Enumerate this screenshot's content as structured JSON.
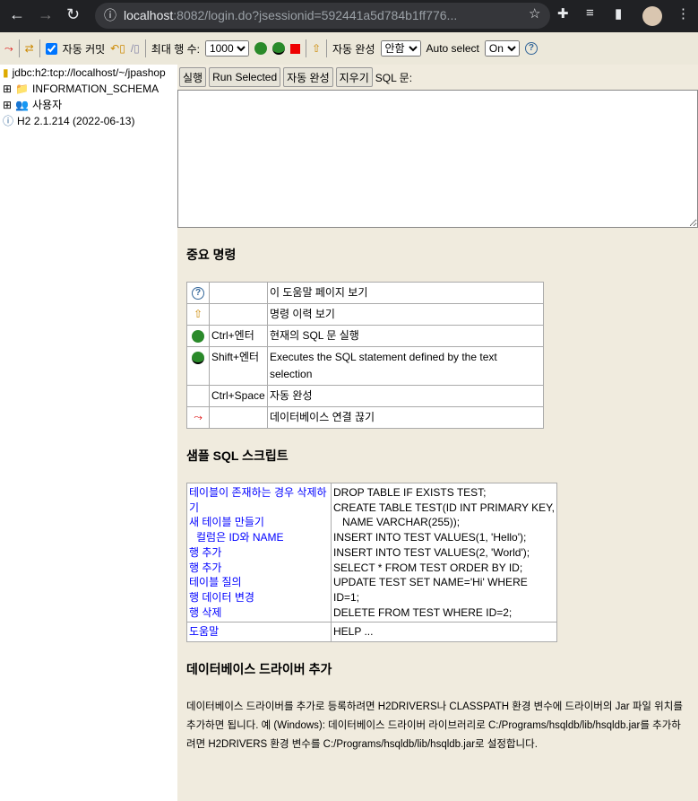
{
  "browser": {
    "url_host": "localhost",
    "url_rest": ":8082/login.do?jsessionid=592441a5d784b1ff776..."
  },
  "toolbar": {
    "autocommit_label": "자동 커밋",
    "autocommit_checked": true,
    "max_rows_label": "최대 행 수:",
    "max_rows_value": "1000",
    "autocomplete_label": "자동 완성",
    "autocomplete_value": "안함",
    "autoselect_label": "Auto select",
    "autoselect_value": "On"
  },
  "tree": {
    "connection": "jdbc:h2:tcp://localhost/~/jpashop",
    "items": [
      "INFORMATION_SCHEMA",
      "사용자"
    ],
    "version": "H2 2.1.214 (2022-06-13)"
  },
  "buttons": {
    "run": "실행",
    "run_selected": "Run Selected",
    "autocomplete": "자동 완성",
    "clear": "지우기",
    "sql_label": "SQL 문:"
  },
  "help": {
    "important_title": "중요 명령",
    "commands": [
      {
        "icon": "help-icon",
        "key": "",
        "desc": "이 도움말 페이지 보기"
      },
      {
        "icon": "history-icon",
        "key": "",
        "desc": "명령 이력 보기"
      },
      {
        "icon": "run-icon",
        "key": "Ctrl+엔터",
        "desc": "현재의 SQL 문 실행"
      },
      {
        "icon": "run-selected-icon",
        "key": "Shift+엔터",
        "desc": "Executes the SQL statement defined by the text selection"
      },
      {
        "icon": "",
        "key": "Ctrl+Space",
        "desc": "자동 완성"
      },
      {
        "icon": "disconnect-icon",
        "key": "",
        "desc": "데이터베이스 연결 끊기"
      }
    ],
    "sample_title": "샘플 SQL 스크립트",
    "samples": [
      {
        "label": "테이블이 존재하는 경우 삭제하기",
        "sql": "DROP TABLE IF EXISTS TEST;"
      },
      {
        "label": "새 테이블 만들기",
        "sql": "CREATE TABLE TEST(ID INT PRIMARY KEY,"
      },
      {
        "label": "컬럼은 ID와 NAME",
        "sql": "NAME VARCHAR(255));"
      },
      {
        "label": "행 추가",
        "sql": "INSERT INTO TEST VALUES(1, 'Hello');"
      },
      {
        "label": "행 추가",
        "sql": "INSERT INTO TEST VALUES(2, 'World');"
      },
      {
        "label": "테이블 질의",
        "sql": "SELECT * FROM TEST ORDER BY ID;"
      },
      {
        "label": "행 데이터 변경",
        "sql": "UPDATE TEST SET NAME='Hi' WHERE ID=1;"
      },
      {
        "label": "행 삭제",
        "sql": "DELETE FROM TEST WHERE ID=2;"
      }
    ],
    "help_row": {
      "label": "도움말",
      "sql": "HELP ..."
    },
    "driver_title": "데이터베이스 드라이버 추가",
    "driver_text": "데이터베이스 드라이버를 추가로 등록하려면 H2DRIVERS나 CLASSPATH 환경 변수에 드라이버의 Jar 파일 위치를 추가하면 됩니다. 예 (Windows): 데이터베이스 드라이버 라이브러리로 C:/Programs/hsqldb/lib/hsqldb.jar를 추가하려면 H2DRIVERS 환경 변수를 C:/Programs/hsqldb/lib/hsqldb.jar로 설정합니다."
  }
}
